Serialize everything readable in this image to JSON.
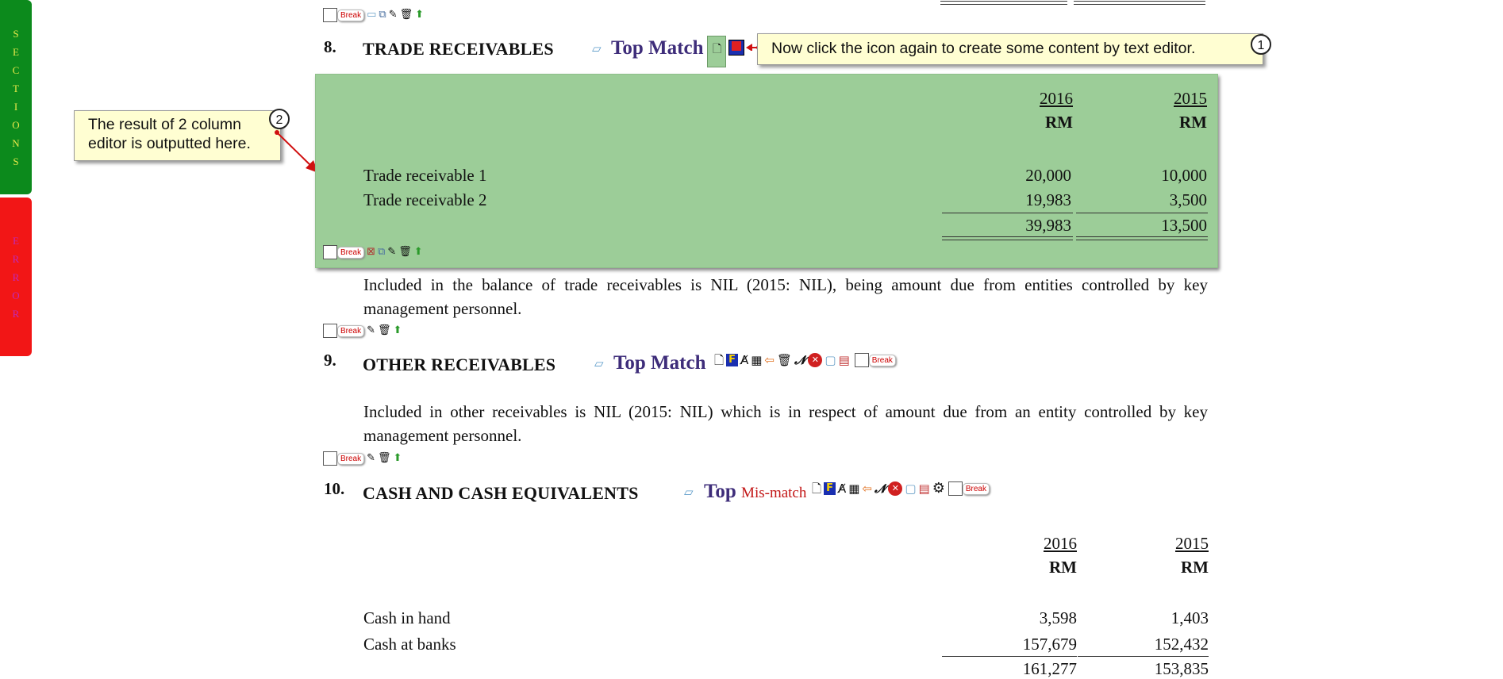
{
  "side_tabs": {
    "sections": "SECTIONS",
    "error": "ERROR"
  },
  "break_label": "Break",
  "section8": {
    "number": "8.",
    "title": "TRADE RECEIVABLES",
    "top": "Top",
    "match": "Match",
    "callout": "Now click the icon again to create some content by text editor.",
    "callout_step": "1",
    "table": {
      "years": [
        "2016",
        "2015"
      ],
      "currency": [
        "RM",
        "RM"
      ],
      "rows": [
        {
          "label": "Trade receivable 1",
          "v2016": "20,000",
          "v2015": "10,000"
        },
        {
          "label": "Trade receivable 2",
          "v2016": "19,983",
          "v2015": "3,500"
        }
      ],
      "total": {
        "v2016": "39,983",
        "v2015": "13,500"
      }
    },
    "note": "Included in the balance of trade receivables is NIL (2015: NIL), being amount due from entities controlled by key management personnel."
  },
  "result_callout": {
    "text_line1": "The result of 2 column",
    "text_line2": "editor is outputted here.",
    "step": "2"
  },
  "section9": {
    "number": "9.",
    "title": "OTHER RECEIVABLES",
    "top": "Top",
    "match": "Match",
    "note": "Included in other receivables is NIL (2015: NIL) which is in respect of amount due from an entity controlled by key management personnel."
  },
  "section10": {
    "number": "10.",
    "title": "CASH AND CASH EQUIVALENTS",
    "top": "Top",
    "match": "Mis-match",
    "table": {
      "years": [
        "2016",
        "2015"
      ],
      "currency": [
        "RM",
        "RM"
      ],
      "rows": [
        {
          "label": "Cash in hand",
          "v2016": "3,598",
          "v2015": "1,403"
        },
        {
          "label": "Cash at banks",
          "v2016": "157,679",
          "v2015": "152,432"
        }
      ],
      "total": {
        "v2016": "161,277",
        "v2015": "153,835"
      }
    }
  },
  "colors": {
    "sections_tab": "#0c8a1c",
    "error_tab": "#f21616",
    "highlight_box": "#9ccd98",
    "top_match": "#3e2d7a",
    "mismatch": "#c21515",
    "callout_bg": "#fffed2",
    "arrow": "#d01010"
  }
}
